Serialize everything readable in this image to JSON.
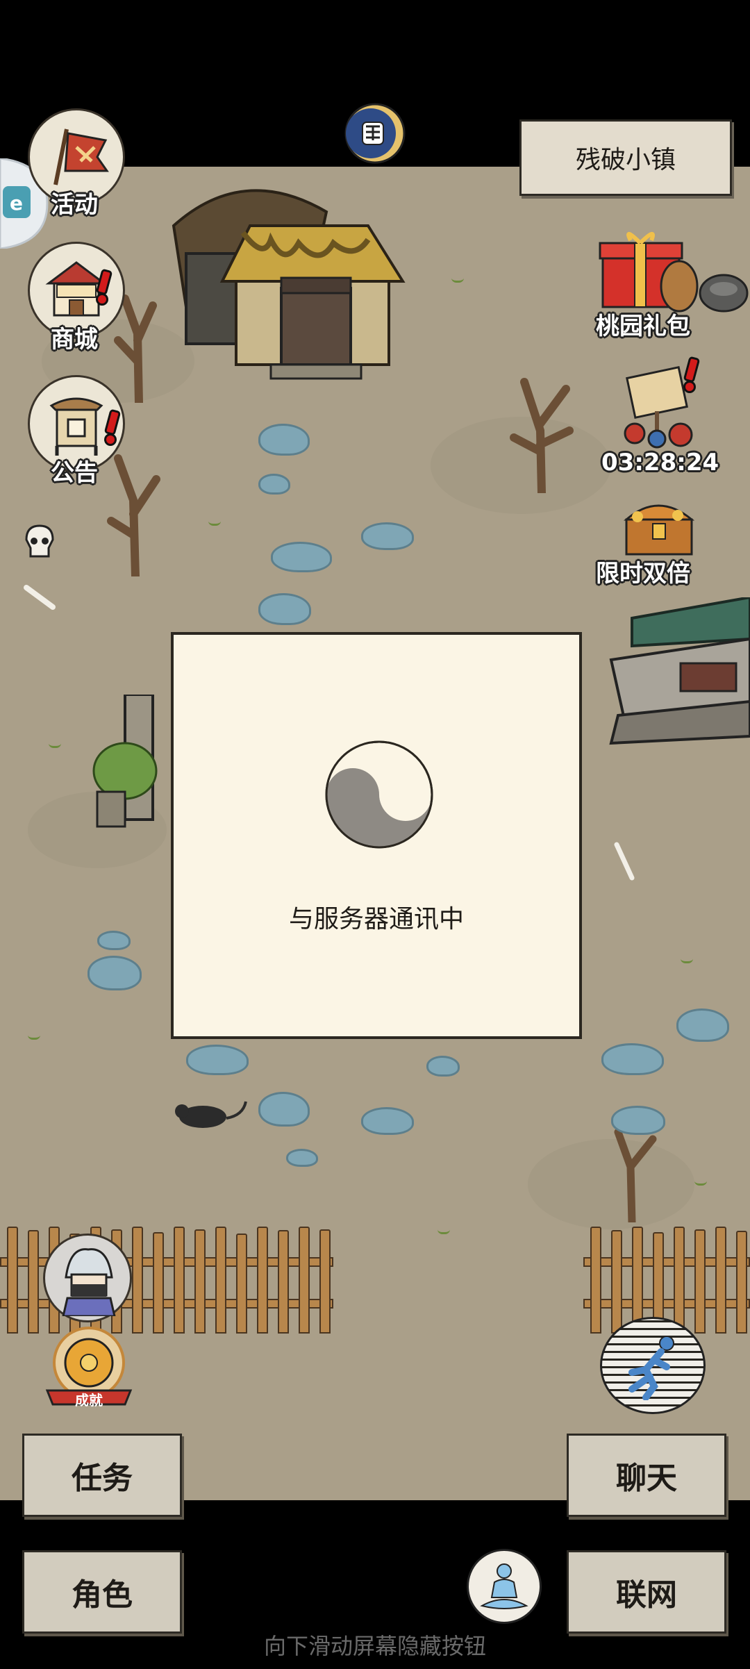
{
  "location": {
    "name": "残破小镇"
  },
  "left_buttons": [
    {
      "label": "活动",
      "icon": "flag-icon"
    },
    {
      "label": "商城",
      "icon": "shop-icon"
    },
    {
      "label": "公告",
      "icon": "notice-board-icon"
    }
  ],
  "right_buttons": [
    {
      "label": "桃园礼包",
      "icon": "gift-box-icon"
    },
    {
      "label": "03:28:24",
      "icon": "sale-sign-icon"
    },
    {
      "label": "限时双倍",
      "icon": "treasure-chest-icon"
    }
  ],
  "badges": {
    "achievement": "成就"
  },
  "dialog": {
    "message": "与服务器通讯中"
  },
  "bottom_menu": {
    "task": "任务",
    "chat": "聊天",
    "character": "角色",
    "network": "联网"
  },
  "hint": "向下滑动屏幕隐藏按钮",
  "colors": {
    "ground": "#aa9f89",
    "dialog_bg": "#fbf5e5",
    "alert": "#d31b1b"
  }
}
